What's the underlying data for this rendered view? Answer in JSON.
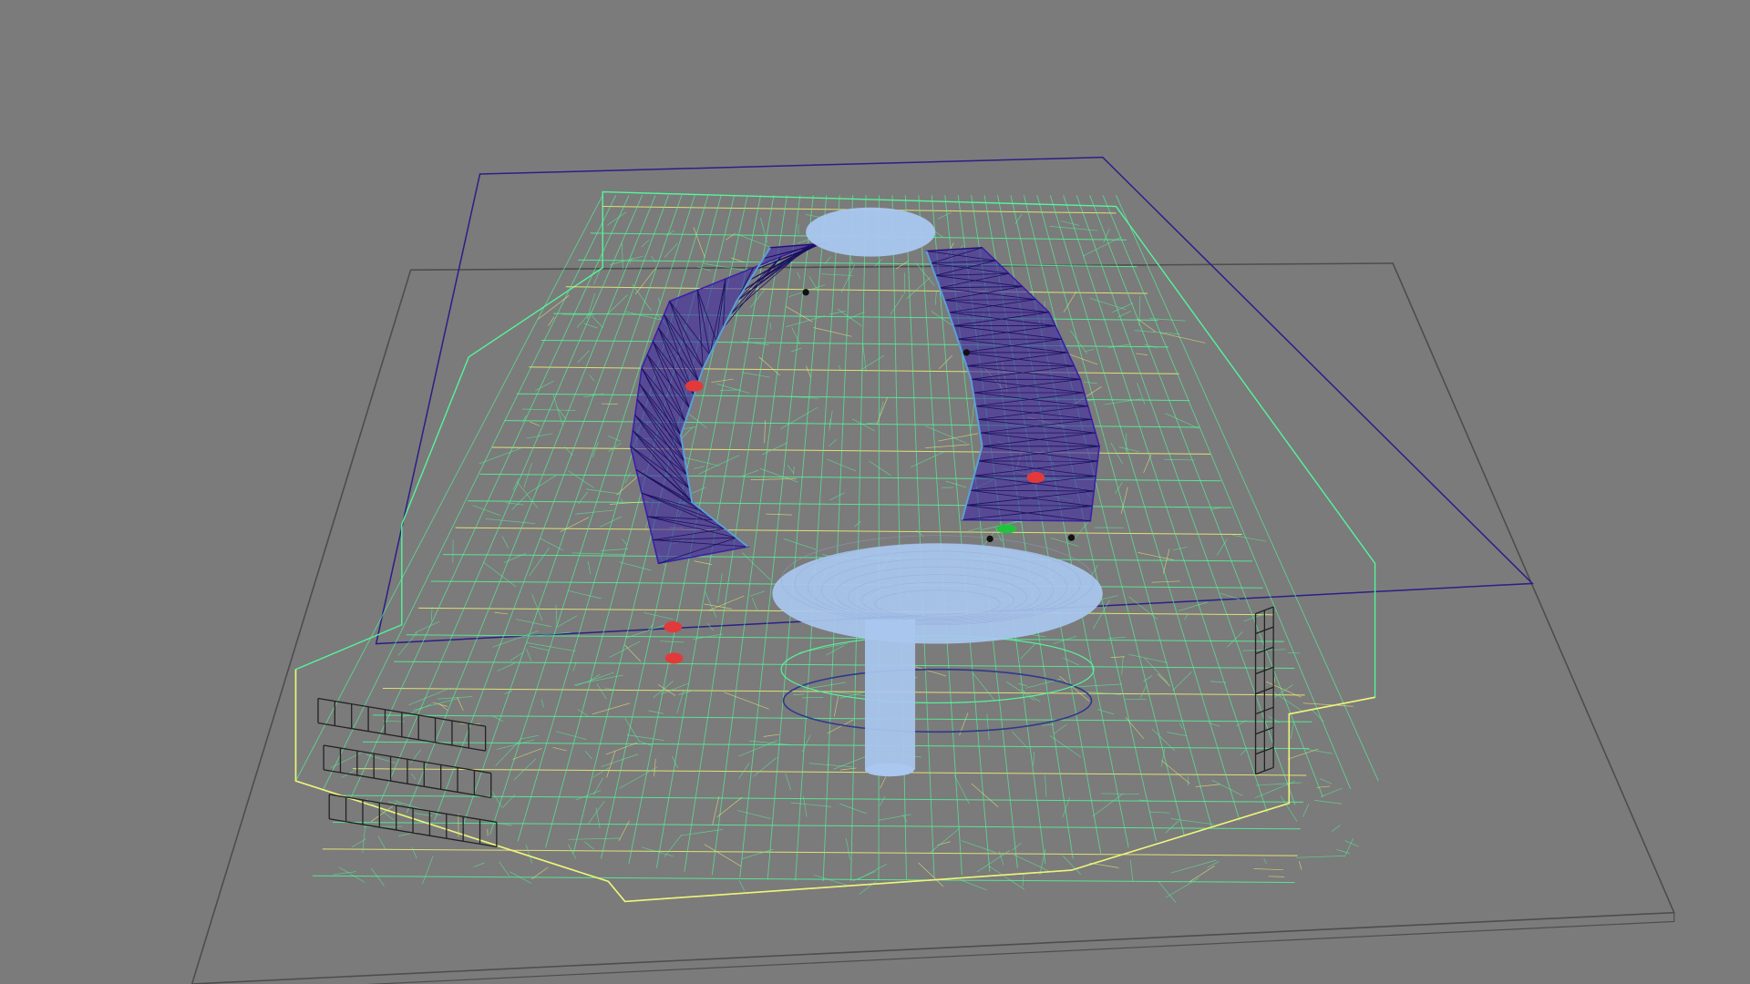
{
  "viewport": {
    "background": "#7b7b7b",
    "ground_plane_color": "#4d4d4d",
    "section_plane_color": "#2a1f86"
  },
  "model": {
    "wire_green": "#55f59a",
    "wire_yellow": "#f2f279",
    "wire_dark": "#222222",
    "roof_truss_color": "#3a21a8",
    "roof_truss_highlight": "#5aa2d6",
    "dome_color": "#a9c7ef",
    "column_color": "#a9c7ef",
    "marker_red": "#e23a3a",
    "marker_green": "#21c23d"
  }
}
